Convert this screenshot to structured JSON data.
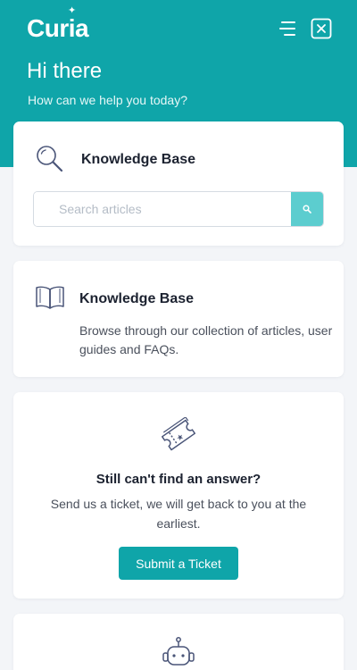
{
  "header": {
    "logo_prefix": "Cur",
    "logo_i": "i",
    "logo_suffix": "a",
    "logo_spark": "✦",
    "menu_icon": "menu-icon",
    "close_icon": "close-icon"
  },
  "hero": {
    "greeting": "Hi there",
    "subtitle": "How can we help you today?"
  },
  "search_card": {
    "icon": "magnifier-icon",
    "title": "Knowledge Base",
    "placeholder": "Search articles",
    "button_icon": "search-icon"
  },
  "kb_card": {
    "icon": "open-book-icon",
    "title": "Knowledge Base",
    "description": "Browse through our collection of articles, user guides and FAQs."
  },
  "ticket_card": {
    "icon": "ticket-icon",
    "title": "Still can't find an answer?",
    "description": "Send us a ticket, we will get back to you at the earliest.",
    "button_label": "Submit a Ticket"
  },
  "chat_card": {
    "icon": "robot-icon"
  },
  "colors": {
    "brand": "#0fa5a9",
    "search_button": "#5ccdcf",
    "background": "#f3f5f8",
    "icon_stroke": "#4a5578"
  }
}
